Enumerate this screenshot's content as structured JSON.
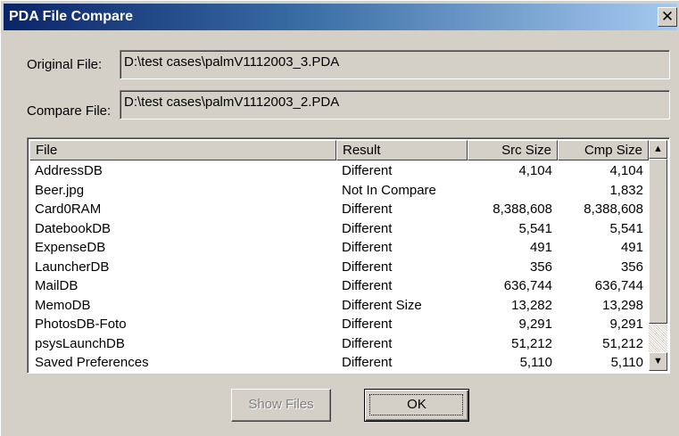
{
  "window": {
    "title": "PDA File Compare",
    "close_glyph": "✕"
  },
  "original_file": {
    "label": "Original File:",
    "value": "D:\\test cases\\palmV1112003_3.PDA"
  },
  "compare_file": {
    "label": "Compare File:",
    "value": "D:\\test cases\\palmV1112003_2.PDA"
  },
  "table": {
    "columns": [
      "File",
      "Result",
      "Src Size",
      "Cmp Size"
    ],
    "rows": [
      [
        "AddressDB",
        "Different",
        "4,104",
        "4,104"
      ],
      [
        "Beer.jpg",
        "Not In Compare",
        "",
        "1,832"
      ],
      [
        "Card0RAM",
        "Different",
        "8,388,608",
        "8,388,608"
      ],
      [
        "DatebookDB",
        "Different",
        "5,541",
        "5,541"
      ],
      [
        "ExpenseDB",
        "Different",
        "491",
        "491"
      ],
      [
        "LauncherDB",
        "Different",
        "356",
        "356"
      ],
      [
        "MailDB",
        "Different",
        "636,744",
        "636,744"
      ],
      [
        "MemoDB",
        "Different Size",
        "13,282",
        "13,298"
      ],
      [
        "PhotosDB-Foto",
        "Different",
        "9,291",
        "9,291"
      ],
      [
        "psysLaunchDB",
        "Different",
        "51,212",
        "51,212"
      ],
      [
        "Saved Preferences",
        "Different",
        "5,110",
        "5,110"
      ]
    ]
  },
  "scrollbar": {
    "up_glyph": "▲",
    "down_glyph": "▼"
  },
  "buttons": {
    "show_files": "Show Files",
    "ok": "OK"
  },
  "colors": {
    "title_gradient_start": "#0a246a",
    "title_gradient_end": "#a6caf0",
    "face": "#d4d0c8"
  }
}
